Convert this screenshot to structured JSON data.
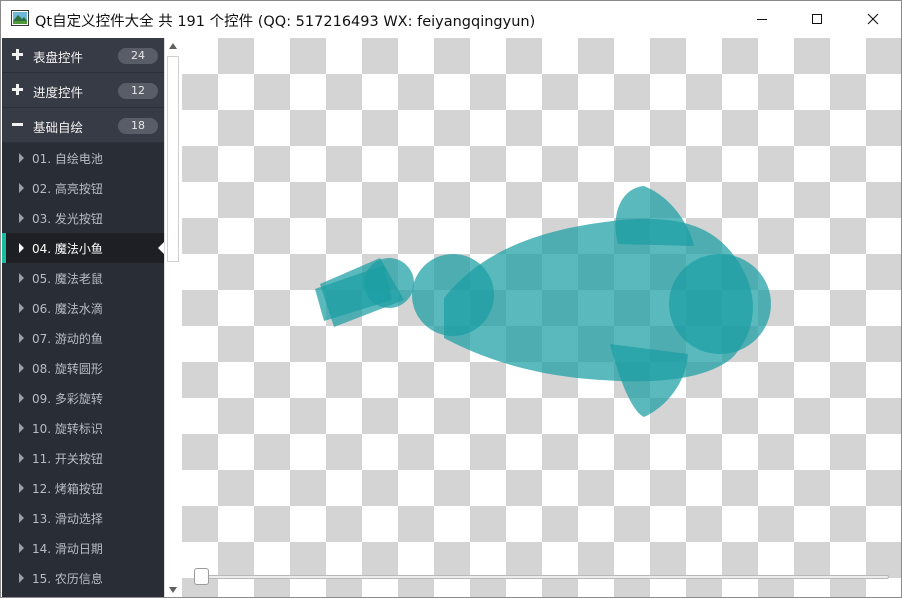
{
  "window": {
    "title": "Qt自定义控件大全 共 191 个控件 (QQ: 517216493 WX: feiyangqingyun)",
    "icon": "app-icon",
    "buttons": [
      "minimize-icon",
      "maximize-icon",
      "close-icon"
    ]
  },
  "sidebar": {
    "groups": [
      {
        "label": "表盘控件",
        "count": "24",
        "expanded": false,
        "icon": "plus-icon"
      },
      {
        "label": "进度控件",
        "count": "12",
        "expanded": false,
        "icon": "plus-icon"
      },
      {
        "label": "基础自绘",
        "count": "18",
        "expanded": true,
        "icon": "minus-icon"
      }
    ],
    "items": [
      {
        "label": "01. 自绘电池"
      },
      {
        "label": "02. 高亮按钮"
      },
      {
        "label": "03. 发光按钮"
      },
      {
        "label": "04. 魔法小鱼",
        "active": true
      },
      {
        "label": "05. 魔法老鼠"
      },
      {
        "label": "06. 魔法水滴"
      },
      {
        "label": "07. 游动的鱼"
      },
      {
        "label": "08. 旋转圆形"
      },
      {
        "label": "09. 多彩旋转"
      },
      {
        "label": "10. 旋转标识"
      },
      {
        "label": "11. 开关按钮"
      },
      {
        "label": "12. 烤箱按钮"
      },
      {
        "label": "13. 滑动选择"
      },
      {
        "label": "14. 滑动日期"
      },
      {
        "label": "15. 农历信息"
      }
    ],
    "accent": "#1abc9c",
    "background": "#292d36"
  },
  "canvas": {
    "background": "checkerboard",
    "fish_color": "#1a9ea3",
    "slider_value": 0
  }
}
